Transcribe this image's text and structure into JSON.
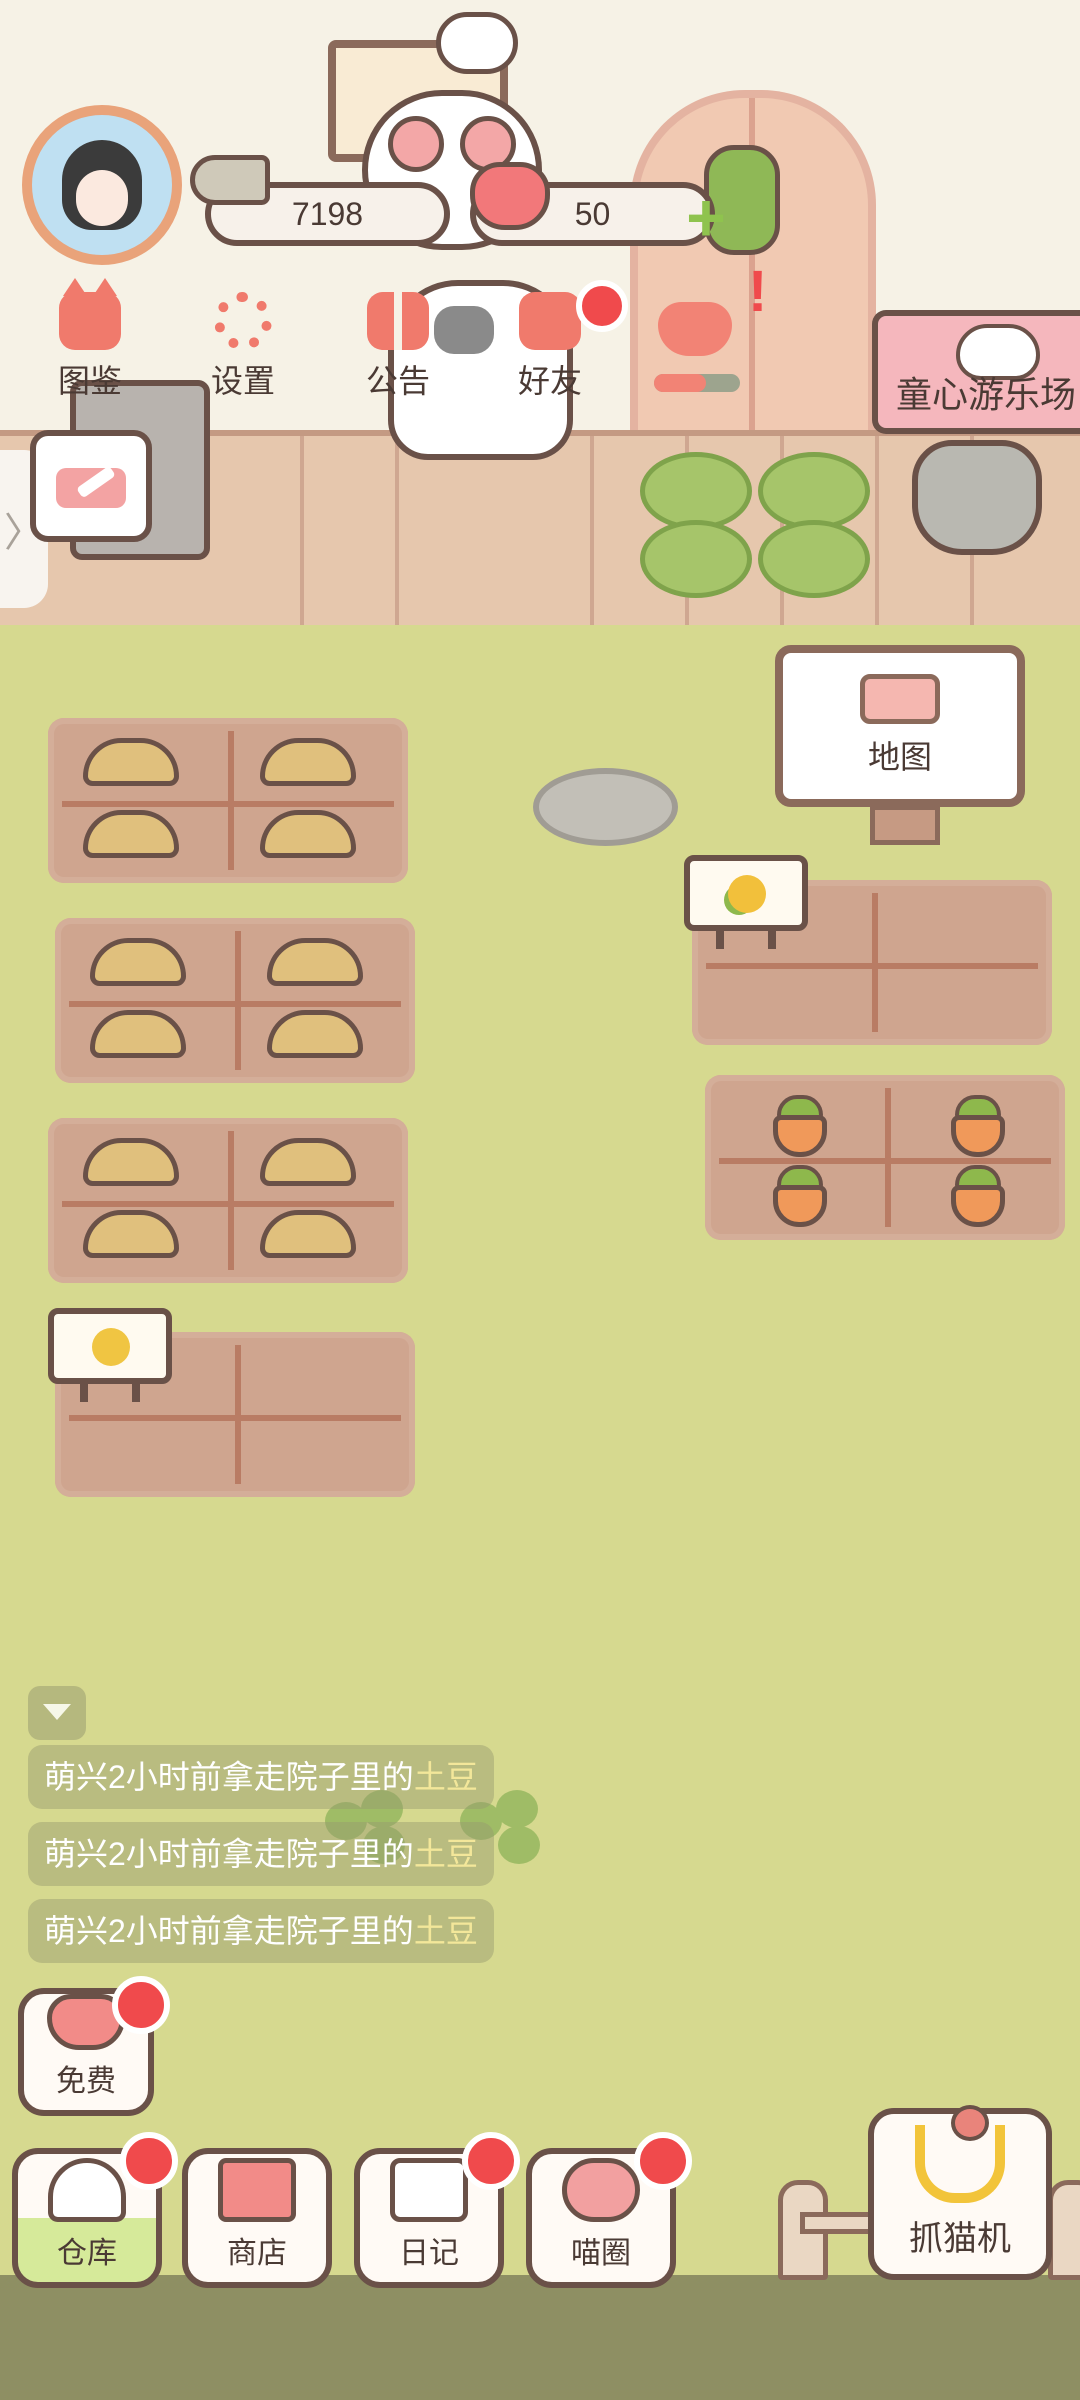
{
  "profile": {
    "avatar": "player-avatar"
  },
  "currency": {
    "coins": "7198",
    "hearts": "50",
    "add_symbol": "+"
  },
  "top_menu": [
    {
      "label": "图鉴",
      "icon": "cat-book-icon"
    },
    {
      "label": "设置",
      "icon": "gear-icon"
    },
    {
      "label": "公告",
      "icon": "gift-icon"
    },
    {
      "label": "好友",
      "icon": "friends-icon"
    }
  ],
  "like": {
    "icon": "heart-hands-icon",
    "exclaim": "!"
  },
  "playground": {
    "label": "童心游乐场",
    "icon": "panda-icon"
  },
  "side_tab": {
    "glyph": "〉"
  },
  "map": {
    "label": "地图",
    "icon": "fence-icon"
  },
  "plots": [
    {
      "crop": "potato"
    },
    {
      "crop": "potato"
    },
    {
      "crop": "potato"
    },
    {
      "crop": "empty",
      "sign": "wheat"
    },
    {
      "crop": "empty",
      "sign": "corn"
    },
    {
      "crop": "carrot"
    }
  ],
  "feed": [
    {
      "prefix": "萌兴2小时前拿走院子里的",
      "item": "土豆"
    },
    {
      "prefix": "萌兴2小时前拿走院子里的",
      "item": "土豆"
    },
    {
      "prefix": "萌兴2小时前拿走院子里的",
      "item": "土豆"
    }
  ],
  "bottom": {
    "free": "免费",
    "warehouse": "仓库",
    "shop": "商店",
    "diary": "日记",
    "circle": "喵圈",
    "claw": "抓猫机"
  },
  "colors": {
    "accent": "#f07a6c",
    "badge": "#f04a4c",
    "outline": "#6a5148",
    "grass": "#d6d98f",
    "soil": "#cfa58f",
    "feed_highlight": "#f3e79a"
  }
}
